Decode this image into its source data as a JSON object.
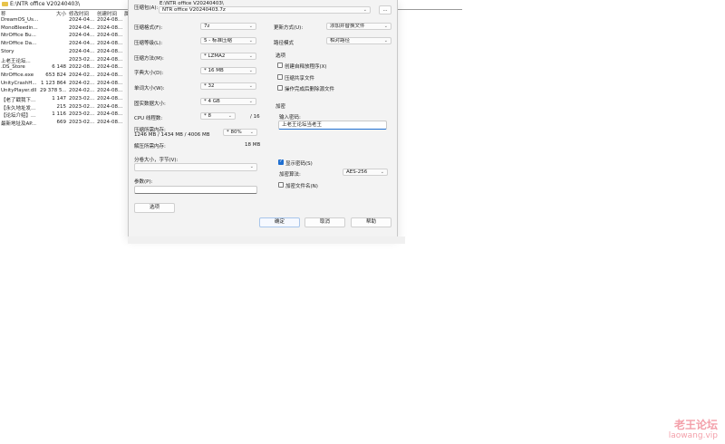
{
  "file_manager": {
    "path": "E:\\NTR office V20240403\\",
    "columns": [
      "称",
      "大小",
      "修改时间",
      "创建时间",
      "属"
    ],
    "rows": [
      {
        "name": "DreamOS_Us...",
        "size": "",
        "modified": "2024-04...",
        "created": "2024-08..."
      },
      {
        "name": "MonoBleedin...",
        "size": "",
        "modified": "2024-04...",
        "created": "2024-08..."
      },
      {
        "name": "NtrOffice Bu...",
        "size": "",
        "modified": "2024-04...",
        "created": "2024-08..."
      },
      {
        "name": "NtrOffice Da...",
        "size": "",
        "modified": "2024-04...",
        "created": "2024-08..."
      },
      {
        "name": "Story",
        "size": "",
        "modified": "2024-04...",
        "created": "2024-08..."
      },
      {
        "name": "上老王论坛...",
        "size": "",
        "modified": "2023-02...",
        "created": "2024-08..."
      },
      {
        "name": ".DS_Store",
        "size": "6 148",
        "modified": "2022-08...",
        "created": "2024-08..."
      },
      {
        "name": "NtrOffice.exe",
        "size": "653 824",
        "modified": "2024-02...",
        "created": "2024-08..."
      },
      {
        "name": "UnityCrashH...",
        "size": "1 123 864",
        "modified": "2024-02...",
        "created": "2024-08..."
      },
      {
        "name": "UnityPlayer.dll",
        "size": "29 378 5...",
        "modified": "2024-02...",
        "created": "2024-08..."
      },
      {
        "name": "【老了戳我下...",
        "size": "1 147",
        "modified": "2023-02...",
        "created": "2024-08..."
      },
      {
        "name": "【永久地址发...",
        "size": "215",
        "modified": "2023-02...",
        "created": "2024-08..."
      },
      {
        "name": "【论坛介绍】...",
        "size": "1 116",
        "modified": "2023-02...",
        "created": "2024-08..."
      },
      {
        "name": "最新地址及AP...",
        "size": "669",
        "modified": "2023-02...",
        "created": "2024-08..."
      }
    ]
  },
  "dialog": {
    "archive_label": "压缩包(A):",
    "archive_dir": "E:\\NTR office V20240403\\",
    "archive_name": "NTR office V20240403.7z",
    "browse_label": "...",
    "format_label": "压缩格式(F):",
    "format_value": "7z",
    "level_label": "压缩等级(L):",
    "level_value": "5 - 标准压缩",
    "method_label": "压缩方法(M):",
    "method_value": "* LZMA2",
    "dict_label": "字典大小(D):",
    "dict_value": "* 16 MB",
    "word_label": "单词大小(W):",
    "word_value": "* 32",
    "solid_label": "固实数据大小:",
    "solid_value": "* 4 GB",
    "cpu_label": "CPU 线程数:",
    "cpu_value": "* 8",
    "cpu_total": "/ 16",
    "mem_comp_label": "压缩所需内存:",
    "mem_comp_detail": "1246 MB / 1434 MB / 4006 MB",
    "mem_percent": "* 80%",
    "mem_decomp_label": "解压所需内存:",
    "mem_decomp_value": "18 MB",
    "split_label": "分卷大小，字节(V):",
    "split_value": "",
    "params_label": "参数(P):",
    "params_value": "",
    "options_button": "选项",
    "update_label": "更新方式(U):",
    "update_value": "添加并替换文件",
    "path_mode_label": "路径模式",
    "path_mode_value": "相对路径",
    "options_group": "选项",
    "opt_sfx": "创建自释放程序(X)",
    "opt_shared": "压缩共享文件",
    "opt_delete": "操作完成后删除源文件",
    "enc_group": "加密",
    "password_label": "输入密码:",
    "password_value": "上老王论坛当老王",
    "show_password": "显示密码(S)",
    "enc_method_label": "加密算法:",
    "enc_method_value": "AES-256",
    "encrypt_names": "加密文件名(N)",
    "ok_button": "确定",
    "cancel_button": "取消",
    "help_button": "帮助"
  },
  "watermark": {
    "title": "老王论坛",
    "url": "laowang.vip"
  },
  "colors": {
    "accent": "#1f6fd1",
    "watermark": "#f3a0aa"
  }
}
